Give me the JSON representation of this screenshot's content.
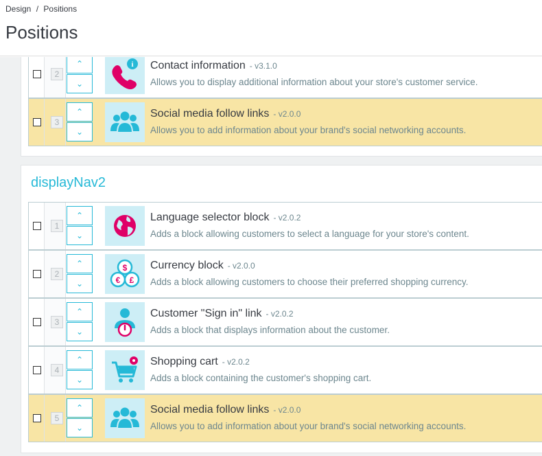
{
  "breadcrumb": {
    "parent": "Design",
    "separator": "/",
    "current": "Positions"
  },
  "page_title": "Positions",
  "hooks": [
    {
      "title": "",
      "modules": [
        {
          "position": "2",
          "name": "Contact information",
          "version": "- v3.1.0",
          "description": "Allows you to display additional information about your store's customer service.",
          "icon": "contact-phone-icon",
          "highlight": false
        },
        {
          "position": "3",
          "name": "Social media follow links",
          "version": "- v2.0.0",
          "description": "Allows you to add information about your brand's social networking accounts.",
          "icon": "social-people-icon",
          "highlight": true
        }
      ]
    },
    {
      "title": "displayNav2",
      "modules": [
        {
          "position": "1",
          "name": "Language selector block",
          "version": "- v2.0.2",
          "description": "Adds a block allowing customers to select a language for your store's content.",
          "icon": "globe-icon",
          "highlight": false
        },
        {
          "position": "2",
          "name": "Currency block",
          "version": "- v2.0.0",
          "description": "Adds a block allowing customers to choose their preferred shopping currency.",
          "icon": "currency-coins-icon",
          "highlight": false
        },
        {
          "position": "3",
          "name": "Customer \"Sign in\" link",
          "version": "- v2.0.2",
          "description": "Adds a block that displays information about the customer.",
          "icon": "user-power-icon",
          "highlight": false
        },
        {
          "position": "4",
          "name": "Shopping cart",
          "version": "- v2.0.2",
          "description": "Adds a block containing the customer's shopping cart.",
          "icon": "shopping-cart-icon",
          "highlight": false
        },
        {
          "position": "5",
          "name": "Social media follow links",
          "version": "- v2.0.0",
          "description": "Allows you to add information about your brand's social networking accounts.",
          "icon": "social-people-icon",
          "highlight": true
        }
      ]
    }
  ],
  "controls": {
    "up_arrow": "⌃",
    "down_arrow": "⌄"
  },
  "colors": {
    "accent": "#25b9d7",
    "highlight": "#f8e5a5",
    "icon_bg": "#cdeef6",
    "icon_pink": "#df0067"
  }
}
